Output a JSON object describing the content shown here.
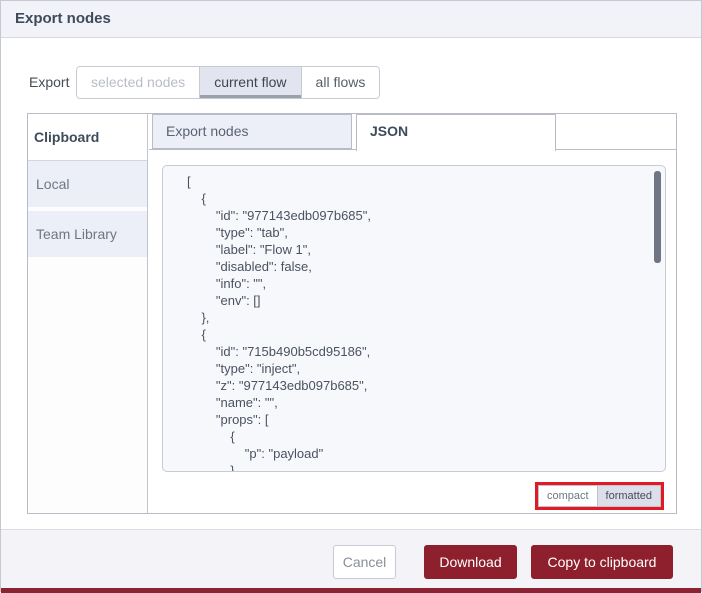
{
  "dialog": {
    "title": "Export nodes"
  },
  "export_row": {
    "label": "Export",
    "options": [
      {
        "label": "selected nodes",
        "state": "disabled"
      },
      {
        "label": "current flow",
        "state": "selected"
      },
      {
        "label": "all flows",
        "state": "normal"
      }
    ]
  },
  "library": {
    "sidebar_header": "Clipboard",
    "sidebar_items": [
      {
        "label": "Local"
      },
      {
        "label": "Team Library"
      }
    ],
    "tabs": [
      {
        "label": "Export nodes",
        "state": "inactive"
      },
      {
        "label": "JSON",
        "state": "active"
      }
    ]
  },
  "json_editor": {
    "lines": [
      "[",
      "    {",
      "        \"id\": \"977143edb097b685\",",
      "        \"type\": \"tab\",",
      "        \"label\": \"Flow 1\",",
      "        \"disabled\": false,",
      "        \"info\": \"\",",
      "        \"env\": []",
      "    },",
      "    {",
      "        \"id\": \"715b490b5cd95186\",",
      "        \"type\": \"inject\",",
      "        \"z\": \"977143edb097b685\",",
      "        \"name\": \"\",",
      "        \"props\": [",
      "            {",
      "                \"p\": \"payload\"",
      "            },"
    ],
    "format_toggle": {
      "compact": "compact",
      "formatted": "formatted",
      "selected": "formatted"
    }
  },
  "footer": {
    "cancel_label": "Cancel",
    "download_label": "Download",
    "copy_label": "Copy to clipboard"
  },
  "colors": {
    "primary_button": "#8e202d",
    "annotation_highlight": "#e01b24",
    "header_bg": "#f2f3f9",
    "inactive_tab_bg": "#edeff8"
  }
}
